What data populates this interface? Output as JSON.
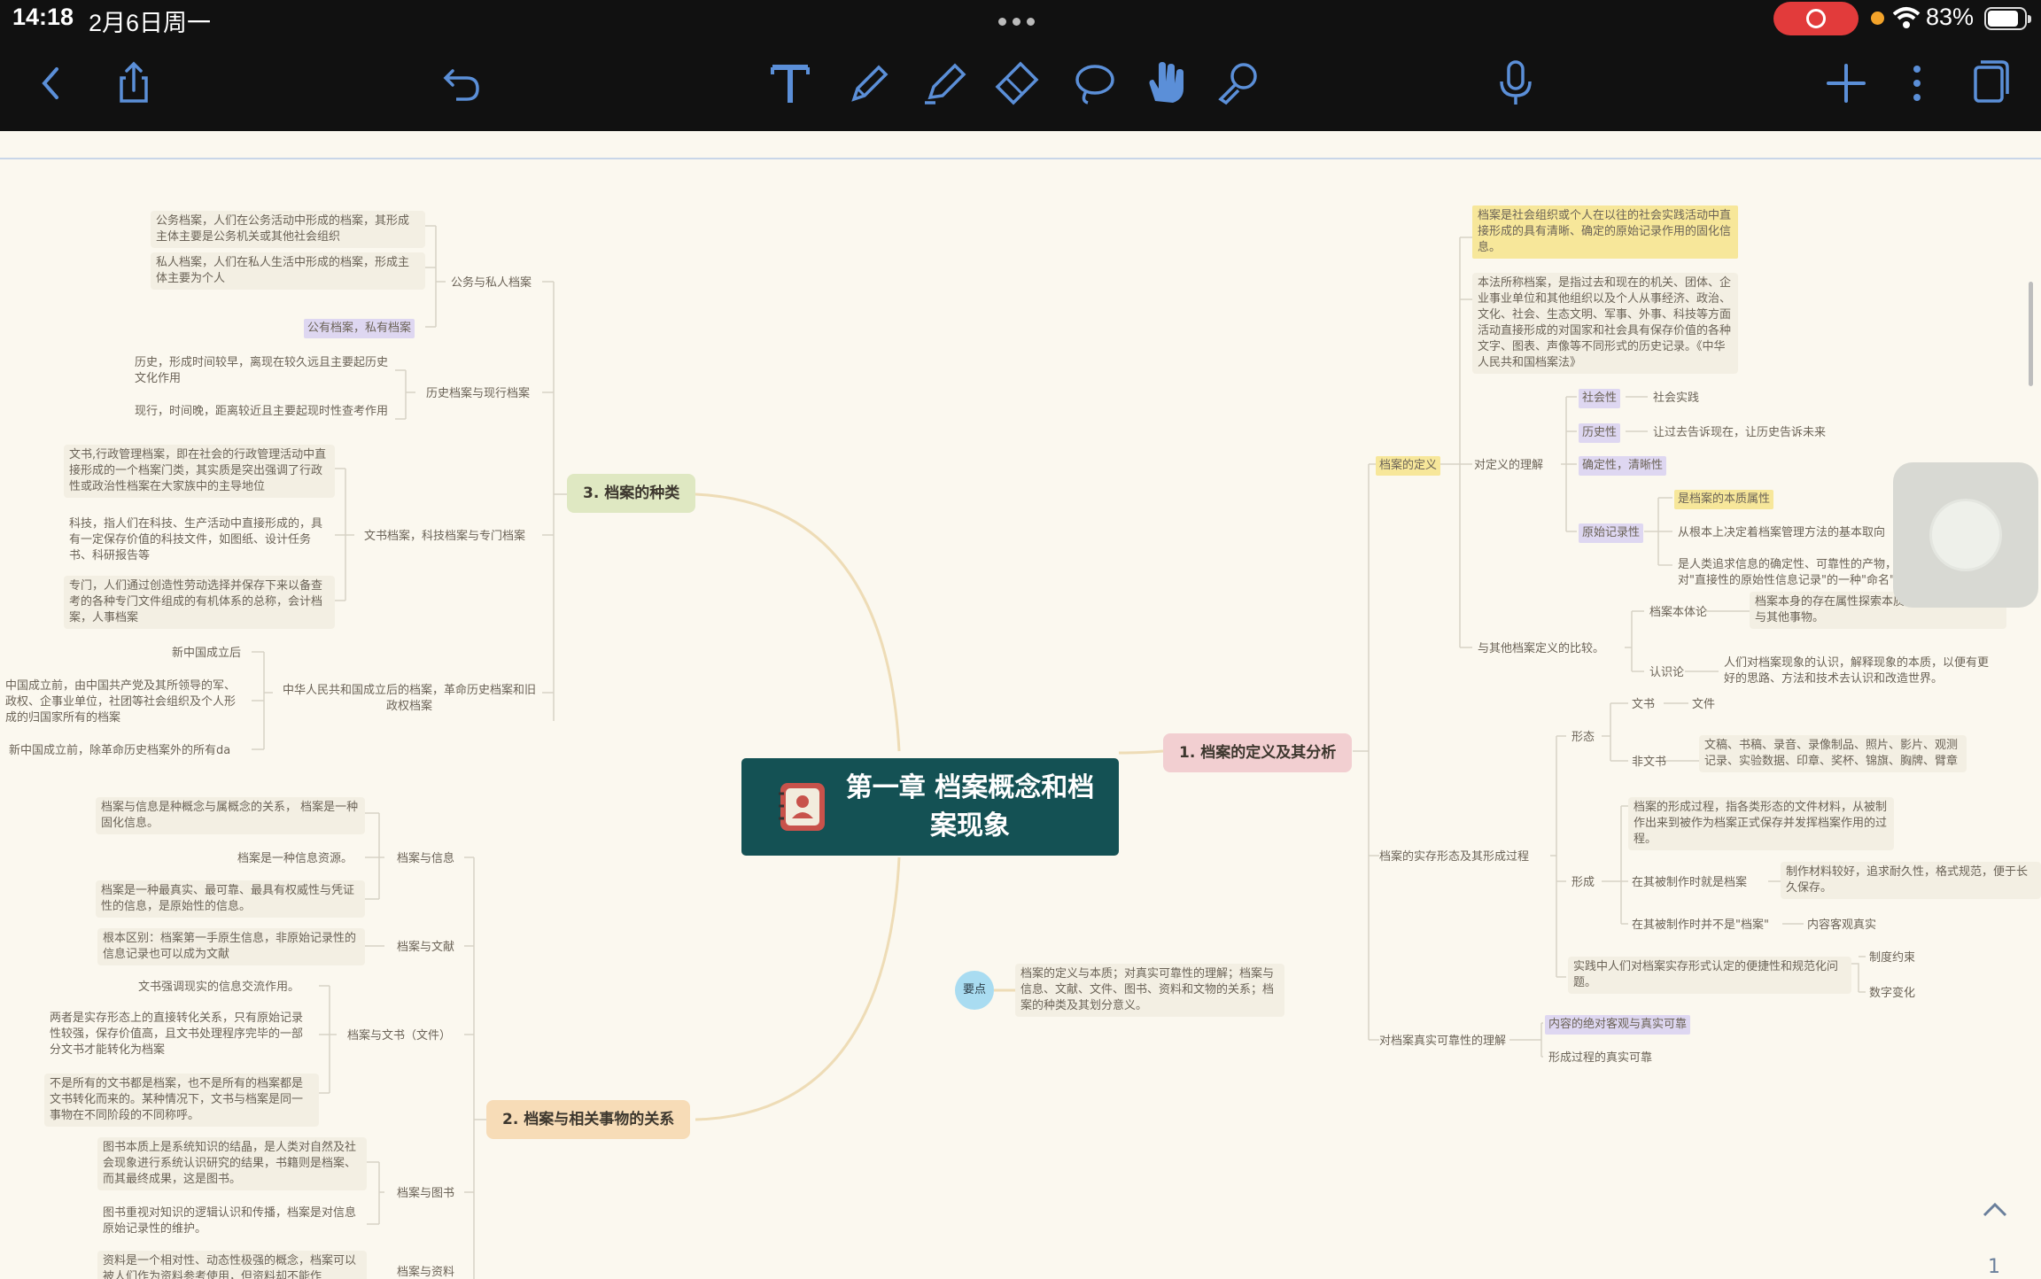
{
  "status": {
    "time": "14:18",
    "date": "2月6日周一",
    "battery": "83%"
  },
  "toolbar": {
    "icons": [
      "back-icon",
      "share-icon",
      "undo-icon",
      "text-icon",
      "pen-icon",
      "highlighter-icon",
      "eraser-icon",
      "lasso-icon",
      "hand-icon",
      "laser-icon",
      "microphone-icon",
      "add-icon",
      "more-icon",
      "pages-icon"
    ]
  },
  "mindmap": {
    "root": "第一章 档案概念和档案现象",
    "b1": "1. 档案的定义及其分析",
    "b2": "2. 档案与相关事物的关系",
    "b3": "3. 档案的种类",
    "key_label": "要点",
    "key_text": "档案的定义与本质；对真实可靠性的理解；档案与信息、文献、文件、图书、资料和文物的关系；档案的种类及其划分意义。",
    "right": {
      "def": "档案的定义",
      "def1": "档案是社会组织或个人在以往的社会实践活动中直接形成的具有清晰、确定的原始记录作用的固化信息。",
      "def2": "本法所称档案，是指过去和现在的机关、团体、企业事业单位和其他组织以及个人从事经济、政治、文化、社会、生态文明、军事、外事、科技等方面活动直接形成的对国家和社会具有保存价值的各种文字、图表、声像等不同形式的历史记录。《中华人民共和国档案法》",
      "understand": "对定义的理解",
      "u_social": "社会性",
      "u_social_v": "社会实践",
      "u_hist": "历史性",
      "u_hist_v": "让过去告诉现在，让历史告诉未来",
      "u_cert": "确定性，清晰性",
      "u_orig": "原始记录性",
      "o1": "是档案的本质属性",
      "o2": "从根本上决定着档案管理方法的基本取向",
      "o3": "是人类追求信息的确定性、可靠性的产物，是人们对\"直接性的原始性信息记录\"的一种\"命名\"",
      "compare": "与其他档案定义的比较。",
      "c_body": "档案本体论",
      "c_body_v": "档案本身的存在属性探索本质属性用于区别档案与其他事物。",
      "c_cog": "认识论",
      "c_cog_v": "人们对档案现象的认识，解释现象的本质，以便有更好的思路、方法和技术去认识和改造世界。",
      "form_proc": "档案的实存形态及其形成过程",
      "f_shape": "形态",
      "f_doc": "文书",
      "f_doc_v": "文件",
      "f_nondoc": "非文书",
      "f_nondoc_v": "文稿、书稿、录音、录像制品、照片、影片、观测记录、实验数据、印章、奖杯、锦旗、胸牌、臂章",
      "f_form": "形成",
      "p1": "档案的形成过程，指各类形态的文件材料，从被制作出来到被作为档案正式保存并发挥档案作用的过程。",
      "p2": "在其被制作时就是档案",
      "p2_v": "制作材料较好，追求耐久性，格式规范，便于长久保存。",
      "p3": "在其被制作时并不是\"档案\"",
      "p3_v": "内容客观真实",
      "practice": "实践中人们对档案实存形式认定的便捷性和规范化问题。",
      "pr1": "制度约束",
      "pr2": "数字变化",
      "truth": "对档案真实可靠性的理解",
      "t1": "内容的绝对客观与真实可靠",
      "t2": "形成过程的真实可靠"
    },
    "left_top": {
      "pub": "公务与私人档案",
      "pub1": "公务档案，人们在公务活动中形成的档案，其形成主体主要是公务机关或其他社会组织",
      "pub2": "私人档案，人们在私人生活中形成的档案，形成主体主要为个人",
      "pub3": "公有档案，私有档案",
      "hist": "历史档案与现行档案",
      "hist1": "历史，形成时间较早，离现在较久远且主要起历史文化作用",
      "hist2": "现行，时间晚，距离较近且主要起现时性查考作用",
      "type": "文书档案，科技档案与专门档案",
      "type1": "文书,行政管理档案，即在社会的行政管理活动中直接形成的一个档案门类，其实质是突出强调了行政性或政治性档案在大家族中的主导地位",
      "type2": "科技，指人们在科技、生产活动中直接形成的，具有一定保存价值的科技文件，如图纸、设计任务书、科研报告等",
      "type3": "专门，人们通过创造性劳动选择并保存下来以备查考的各种专门文件组成的有机体系的总称，会计档案，人事档案",
      "prc": "中华人民共和国成立后的档案，革命历史档案和旧政权档案",
      "prc1": "新中国成立后",
      "prc2": "中国成立前，由中国共产党及其所领导的军、政权、企事业单位，社团等社会组织及个人形成的归国家所有的档案",
      "prc3": "新中国成立前，除革命历史档案外的所有da"
    },
    "left_bottom": {
      "info": "档案与信息",
      "info1": "档案与信息是种概念与属概念的关系， 档案是一种固化信息。",
      "info2": "档案是一种信息资源。",
      "info3": "档案是一种最真实、最可靠、最具有权威性与凭证性的信息，是原始性的信息。",
      "lit": "档案与文献",
      "lit1": "根本区别：档案第一手原生信息，非原始记录性的信息记录也可以成为文献",
      "docs": "档案与文书（文件）",
      "docs1": "文书强调现实的信息交流作用。",
      "docs2": "两者是实存形态上的直接转化关系，只有原始记录性较强，保存价值高，且文书处理程序完毕的一部分文书才能转化为档案",
      "docs3": "不是所有的文书都是档案，也不是所有的档案都是文书转化而来的。某种情况下，文书与档案是同一事物在不同阶段的不同称呼。",
      "book": "档案与图书",
      "book1": "图书本质上是系统知识的结晶，是人类对自然及社会现象进行系统认识研究的结果，书籍则是档案、而其最终成果，这是图书。",
      "book2": "图书重视对知识的逻辑认识和传播，档案是对信息原始记录性的维护。",
      "mat": "档案与资料",
      "mat1": "资料是一个相对性、动态性极强的概念，档案可以被人们作为资料参考使用，但资料却不能作"
    }
  },
  "page_number": "1"
}
